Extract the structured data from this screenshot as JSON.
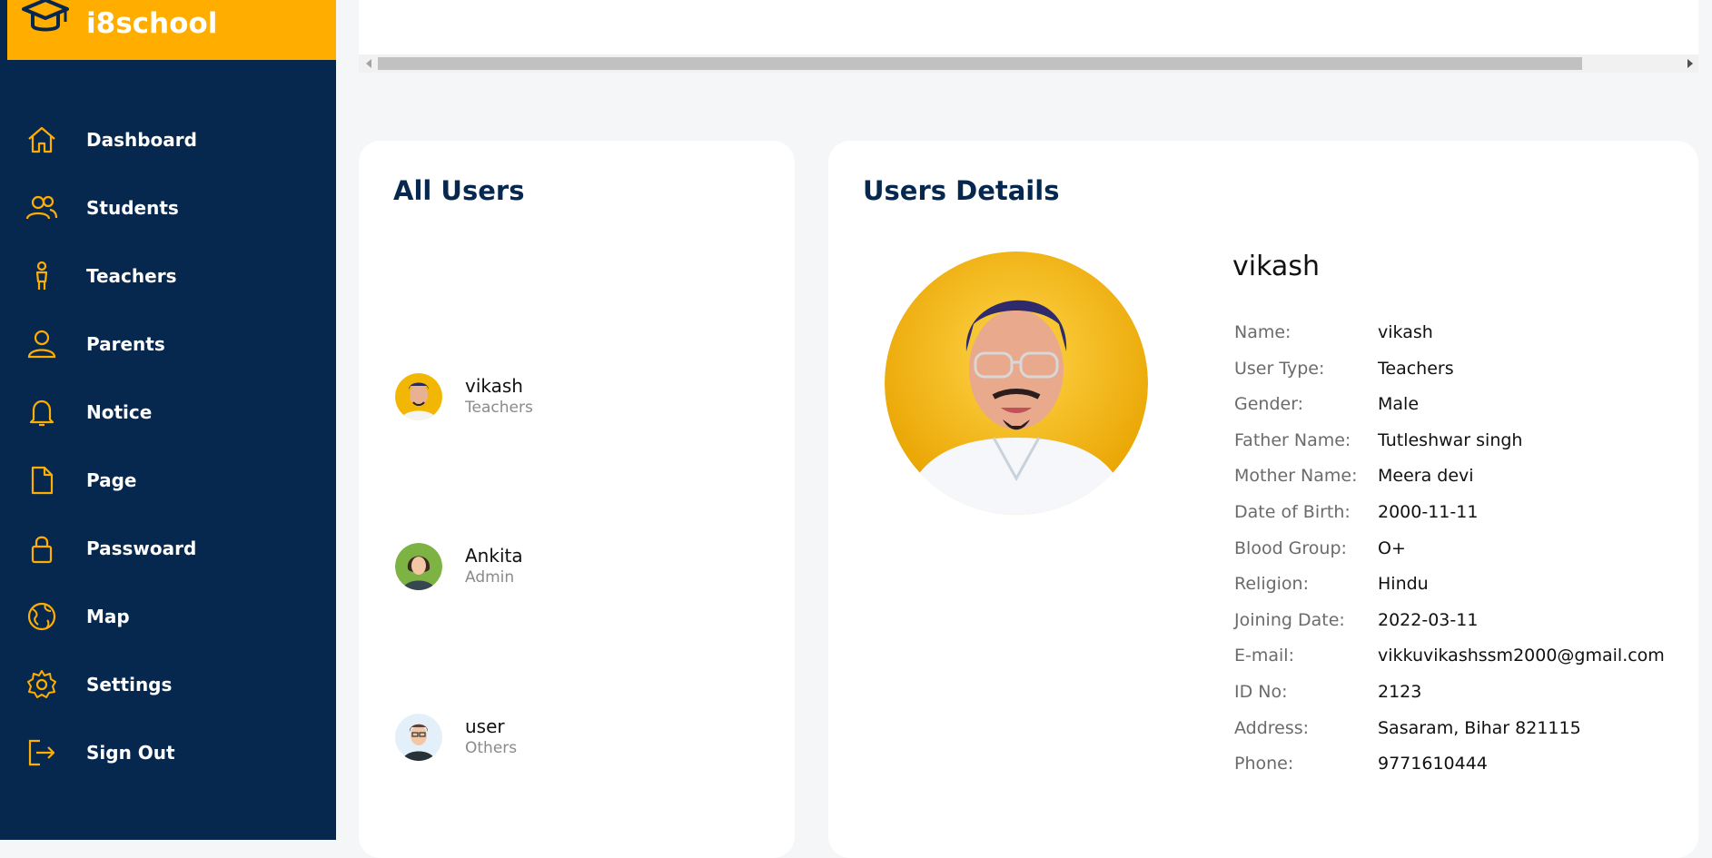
{
  "brand": {
    "name": "i8school",
    "icon": "graduation-cap-icon",
    "color": "#ffae00"
  },
  "sidebar": {
    "background": "#06284f",
    "items": [
      {
        "label": "Dashboard",
        "icon": "home-icon"
      },
      {
        "label": "Students",
        "icon": "users-icon"
      },
      {
        "label": "Teachers",
        "icon": "teacher-icon"
      },
      {
        "label": "Parents",
        "icon": "user-icon"
      },
      {
        "label": "Notice",
        "icon": "bell-icon"
      },
      {
        "label": "Page",
        "icon": "file-icon"
      },
      {
        "label": "Passwoard",
        "icon": "lock-icon"
      },
      {
        "label": "Map",
        "icon": "globe-icon"
      },
      {
        "label": "Settings",
        "icon": "gear-icon"
      },
      {
        "label": "Sign Out",
        "icon": "sign-out-icon"
      }
    ]
  },
  "all_users": {
    "title": "All Users",
    "users": [
      {
        "name": "vikash",
        "role": "Teachers"
      },
      {
        "name": "Ankita",
        "role": "Admin"
      },
      {
        "name": "user",
        "role": "Others"
      }
    ]
  },
  "details": {
    "title": "Users Details",
    "name": "vikash",
    "fields": [
      {
        "key": "Name:",
        "value": "vikash"
      },
      {
        "key": "User Type:",
        "value": "Teachers"
      },
      {
        "key": "Gender:",
        "value": "Male"
      },
      {
        "key": "Father Name:",
        "value": "Tutleshwar singh"
      },
      {
        "key": "Mother Name:",
        "value": "Meera devi"
      },
      {
        "key": "Date of Birth:",
        "value": "2000-11-11"
      },
      {
        "key": "Blood Group:",
        "value": "O+"
      },
      {
        "key": "Religion:",
        "value": "Hindu"
      },
      {
        "key": "Joining Date:",
        "value": "2022-03-11"
      },
      {
        "key": "E-mail:",
        "value": "vikkuvikashssm2000@gmail.com"
      },
      {
        "key": "ID No:",
        "value": "2123"
      },
      {
        "key": "Address:",
        "value": "Sasaram, Bihar 821115"
      },
      {
        "key": "Phone:",
        "value": "9771610444"
      }
    ]
  }
}
